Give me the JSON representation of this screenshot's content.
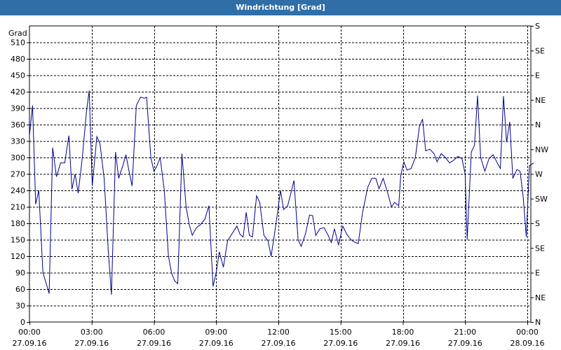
{
  "chart_data": {
    "type": "line",
    "title": "Windrichtung [Grad]",
    "ylabel": "Grad",
    "ylim": [
      0,
      540
    ],
    "yticks": [
      0,
      30,
      60,
      90,
      120,
      150,
      180,
      210,
      240,
      270,
      300,
      330,
      360,
      390,
      420,
      450,
      480,
      510
    ],
    "right_axis": {
      "labels": [
        "N",
        "NE",
        "E",
        "SE",
        "S",
        "SW",
        "W",
        "NW",
        "N",
        "NE",
        "E",
        "SE",
        "S"
      ],
      "values": [
        0,
        45,
        90,
        135,
        180,
        225,
        270,
        315,
        360,
        405,
        450,
        495,
        540
      ]
    },
    "xlim": [
      0,
      24
    ],
    "xticks": [
      {
        "time": "00:00",
        "date": "27.09.16",
        "hour": 0
      },
      {
        "time": "03:00",
        "date": "27.09.16",
        "hour": 3
      },
      {
        "time": "06:00",
        "date": "27.09.16",
        "hour": 6
      },
      {
        "time": "09:00",
        "date": "27.09.16",
        "hour": 9
      },
      {
        "time": "12:00",
        "date": "27.09.16",
        "hour": 12
      },
      {
        "time": "15:00",
        "date": "27.09.16",
        "hour": 15
      },
      {
        "time": "18:00",
        "date": "27.09.16",
        "hour": 18
      },
      {
        "time": "21:00",
        "date": "27.09.16",
        "hour": 21
      },
      {
        "time": "00:00",
        "date": "28.09.16",
        "hour": 24
      }
    ],
    "grid": true,
    "series": [
      {
        "color": "#00008b",
        "points": [
          [
            0.0,
            340
          ],
          [
            0.15,
            395
          ],
          [
            0.3,
            215
          ],
          [
            0.45,
            240
          ],
          [
            0.65,
            90
          ],
          [
            0.85,
            65
          ],
          [
            0.95,
            52
          ],
          [
            1.12,
            318
          ],
          [
            1.3,
            265
          ],
          [
            1.5,
            290
          ],
          [
            1.7,
            290
          ],
          [
            1.9,
            340
          ],
          [
            2.05,
            242
          ],
          [
            2.2,
            270
          ],
          [
            2.35,
            235
          ],
          [
            2.55,
            300
          ],
          [
            2.75,
            385
          ],
          [
            2.88,
            422
          ],
          [
            3.03,
            248
          ],
          [
            3.25,
            338
          ],
          [
            3.4,
            325
          ],
          [
            3.6,
            262
          ],
          [
            3.8,
            130
          ],
          [
            3.95,
            50
          ],
          [
            4.15,
            310
          ],
          [
            4.3,
            262
          ],
          [
            4.5,
            285
          ],
          [
            4.65,
            305
          ],
          [
            4.8,
            275
          ],
          [
            4.95,
            248
          ],
          [
            5.15,
            395
          ],
          [
            5.35,
            410
          ],
          [
            5.55,
            408
          ],
          [
            5.65,
            410
          ],
          [
            5.85,
            300
          ],
          [
            6.0,
            275
          ],
          [
            6.15,
            285
          ],
          [
            6.3,
            300
          ],
          [
            6.5,
            240
          ],
          [
            6.7,
            120
          ],
          [
            6.85,
            90
          ],
          [
            7.0,
            75
          ],
          [
            7.15,
            70
          ],
          [
            7.35,
            307
          ],
          [
            7.55,
            210
          ],
          [
            7.7,
            178
          ],
          [
            7.85,
            158
          ],
          [
            8.05,
            172
          ],
          [
            8.25,
            178
          ],
          [
            8.45,
            187
          ],
          [
            8.65,
            212
          ],
          [
            8.85,
            65
          ],
          [
            9.0,
            90
          ],
          [
            9.15,
            128
          ],
          [
            9.35,
            100
          ],
          [
            9.55,
            148
          ],
          [
            9.75,
            160
          ],
          [
            10.0,
            175
          ],
          [
            10.15,
            160
          ],
          [
            10.3,
            155
          ],
          [
            10.45,
            200
          ],
          [
            10.6,
            158
          ],
          [
            10.75,
            155
          ],
          [
            10.95,
            230
          ],
          [
            11.1,
            218
          ],
          [
            11.3,
            158
          ],
          [
            11.5,
            148
          ],
          [
            11.65,
            120
          ],
          [
            11.85,
            170
          ],
          [
            12.1,
            240
          ],
          [
            12.25,
            205
          ],
          [
            12.45,
            212
          ],
          [
            12.6,
            235
          ],
          [
            12.75,
            258
          ],
          [
            12.95,
            150
          ],
          [
            13.1,
            138
          ],
          [
            13.3,
            160
          ],
          [
            13.5,
            195
          ],
          [
            13.65,
            194
          ],
          [
            13.8,
            158
          ],
          [
            14.0,
            170
          ],
          [
            14.2,
            172
          ],
          [
            14.4,
            158
          ],
          [
            14.55,
            145
          ],
          [
            14.7,
            170
          ],
          [
            14.9,
            140
          ],
          [
            15.1,
            175
          ],
          [
            15.3,
            160
          ],
          [
            15.5,
            150
          ],
          [
            15.7,
            145
          ],
          [
            15.85,
            143
          ],
          [
            16.05,
            198
          ],
          [
            16.3,
            245
          ],
          [
            16.5,
            262
          ],
          [
            16.7,
            262
          ],
          [
            16.85,
            243
          ],
          [
            17.05,
            262
          ],
          [
            17.25,
            238
          ],
          [
            17.45,
            210
          ],
          [
            17.6,
            218
          ],
          [
            17.8,
            212
          ],
          [
            17.9,
            268
          ],
          [
            18.05,
            292
          ],
          [
            18.2,
            277
          ],
          [
            18.4,
            280
          ],
          [
            18.6,
            300
          ],
          [
            18.8,
            357
          ],
          [
            18.95,
            370
          ],
          [
            19.1,
            312
          ],
          [
            19.3,
            315
          ],
          [
            19.5,
            307
          ],
          [
            19.65,
            292
          ],
          [
            19.85,
            307
          ],
          [
            20.05,
            300
          ],
          [
            20.25,
            290
          ],
          [
            20.45,
            295
          ],
          [
            20.65,
            302
          ],
          [
            20.85,
            298
          ],
          [
            21.0,
            270
          ],
          [
            21.1,
            150
          ],
          [
            21.3,
            310
          ],
          [
            21.45,
            322
          ],
          [
            21.6,
            413
          ],
          [
            21.75,
            300
          ],
          [
            21.95,
            275
          ],
          [
            22.15,
            298
          ],
          [
            22.35,
            305
          ],
          [
            22.55,
            290
          ],
          [
            22.7,
            280
          ],
          [
            22.85,
            412
          ],
          [
            23.0,
            328
          ],
          [
            23.15,
            365
          ],
          [
            23.3,
            262
          ],
          [
            23.5,
            278
          ],
          [
            23.65,
            275
          ],
          [
            23.8,
            228
          ],
          [
            23.95,
            155
          ],
          [
            24.1,
            285
          ],
          [
            24.3,
            290
          ]
        ]
      }
    ]
  }
}
